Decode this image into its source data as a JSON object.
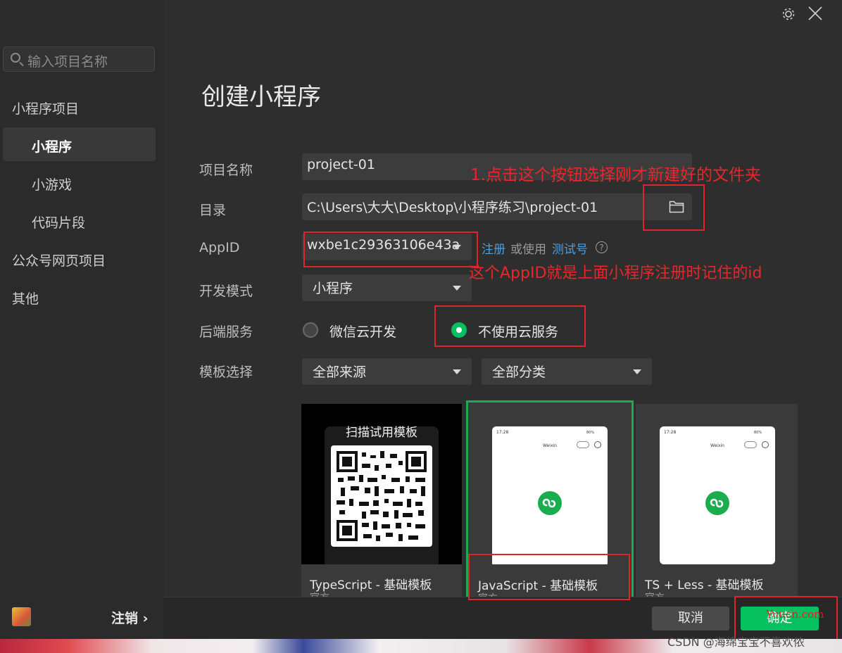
{
  "window": {
    "settings_icon": "gear-icon",
    "close_icon": "close-icon"
  },
  "sidebar": {
    "search_placeholder": "输入项目名称",
    "section_miniprogram": "小程序项目",
    "items": [
      {
        "label": "小程序",
        "active": true
      },
      {
        "label": "小游戏",
        "active": false
      },
      {
        "label": "代码片段",
        "active": false
      }
    ],
    "section_web": "公众号网页项目",
    "section_other": "其他",
    "logout": "注销",
    "logout_chevron": "›"
  },
  "main": {
    "title": "创建小程序",
    "form": {
      "name_label": "项目名称",
      "name_value": "project-01",
      "dir_label": "目录",
      "dir_value": "C:\\Users\\大大\\Desktop\\小程序练习\\project-01",
      "appid_label": "AppID",
      "appid_value": "wxbe1c29363106e43a",
      "register_link": "注册",
      "or_use": "或使用",
      "test_link": "测试号",
      "help": "?",
      "mode_label": "开发模式",
      "mode_value": "小程序",
      "backend_label": "后端服务",
      "backend_options": [
        "微信云开发",
        "不使用云服务"
      ],
      "backend_selected": "不使用云服务",
      "template_label": "模板选择",
      "template_source": "全部来源",
      "template_category": "全部分类"
    },
    "templates": [
      {
        "title": "TypeScript - 基础模板",
        "sub": "官方",
        "scan_text": "扫描试用模板"
      },
      {
        "title": "JavaScript - 基础模板",
        "sub": "官方",
        "selected": true,
        "phone_time": "17:28",
        "phone_title": "Weixin",
        "phone_battery": "80%"
      },
      {
        "title": "TS + Less - 基础模板",
        "sub": "官方",
        "phone_time": "17:28",
        "phone_title": "Weixin",
        "phone_battery": "80%"
      }
    ],
    "cancel_button": "取消",
    "confirm_button": "确定"
  },
  "annotations": {
    "folder_note": "1.点击这个按钮选择刚才新建好的文件夹",
    "appid_note": "这个AppID就是上面小程序注册时记住的id"
  },
  "watermarks": {
    "site": "Yuucn.com",
    "csdn": "CSDN @海绵宝宝不喜欢侬"
  },
  "colors": {
    "accent_green": "#07c160",
    "annotation_red": "#e0242a",
    "link_blue": "#4a9fe0"
  }
}
